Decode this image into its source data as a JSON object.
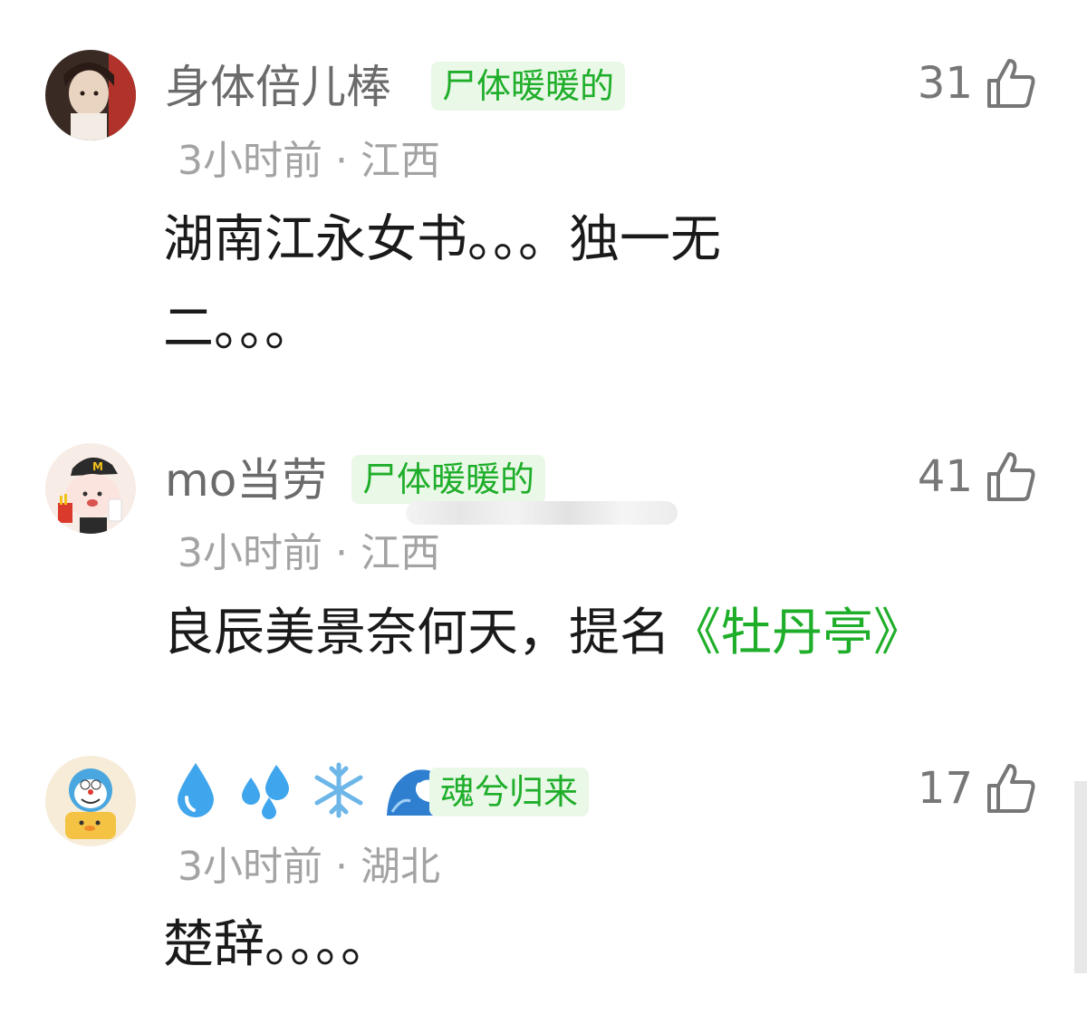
{
  "comments": [
    {
      "username": "身体倍儿棒",
      "tag": "尸体暖暖的",
      "meta": "3小时前 · 江西",
      "content_lines": [
        "湖南江永女书。。。独一无",
        "二。。。"
      ],
      "likes": "31",
      "avatar_icon": "avatar-girl-icon"
    },
    {
      "username": "mo当劳",
      "tag": "尸体暖暖的",
      "meta": "3小时前 · 江西",
      "content_prefix": "良辰美景奈何天，提名",
      "content_highlight": "《牡丹亭》",
      "likes": "41",
      "avatar_icon": "avatar-mcdonalds-mascot-icon"
    },
    {
      "username_icons": [
        "droplet-icon",
        "sweat-droplets-icon",
        "snowflake-icon",
        "wave-icon"
      ],
      "tag": "魂兮归来",
      "meta": "3小时前 · 湖北",
      "content": "楚辞。。。。",
      "likes": "17",
      "avatar_icon": "avatar-doraemon-icon"
    }
  ],
  "colors": {
    "tag_text": "#1fae2a",
    "tag_bg": "#eaf8e8",
    "highlight": "#1fae2a"
  }
}
